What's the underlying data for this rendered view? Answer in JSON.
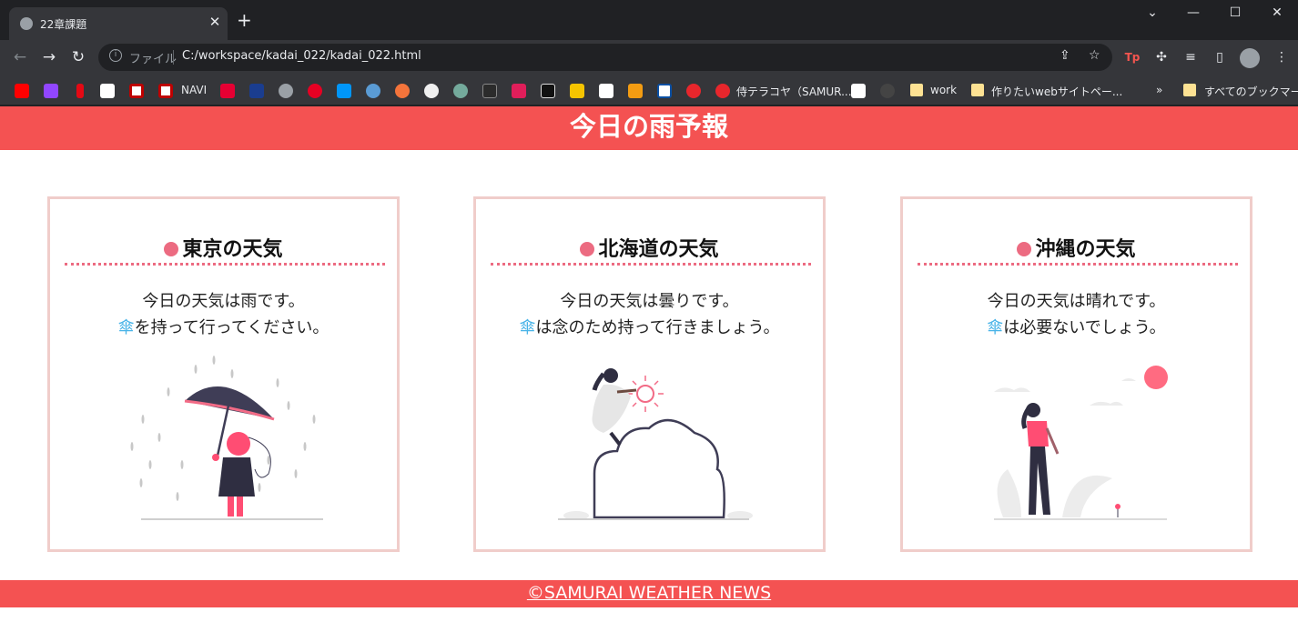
{
  "browser": {
    "tab_title": "22章課題",
    "tab_close": "✕",
    "new_tab": "+",
    "window_controls": {
      "minimize": "—",
      "maximize": "☐",
      "close": "✕",
      "dropdown": "⌄"
    },
    "address": {
      "scheme_label": "ファイル",
      "url": "C:/workspace/kadai_022/kadai_022.html"
    },
    "bookmarks": {
      "navi_label": "NAVI",
      "terakoya_label": "侍テラコヤ（SAMUR...",
      "work_label": "work",
      "want_label": "作りたいwebサイトペー...",
      "more_label": "»",
      "all_label": "すべてのブックマーク"
    },
    "extension_tp": "Tp"
  },
  "page": {
    "title": "今日の雨予報",
    "footer": "©SAMURAI WEATHER NEWS",
    "cards": [
      {
        "heading": "東京の天気",
        "line1": "今日の天気は雨です。",
        "umbrella": "傘",
        "line2_rest": "を持って行ってください。"
      },
      {
        "heading": "北海道の天気",
        "line1": "今日の天気は曇りです。",
        "umbrella": "傘",
        "line2_rest": "は念のため持って行きましょう。"
      },
      {
        "heading": "沖縄の天気",
        "line1": "今日の天気は晴れです。",
        "umbrella": "傘",
        "line2_rest": "は必要ないでしょう。"
      }
    ]
  },
  "colors": {
    "header_red": "#f45252",
    "card_border": "#f0cdca",
    "accent_pink": "#ec6b81",
    "umbrella_blue": "#4ab4e8"
  }
}
